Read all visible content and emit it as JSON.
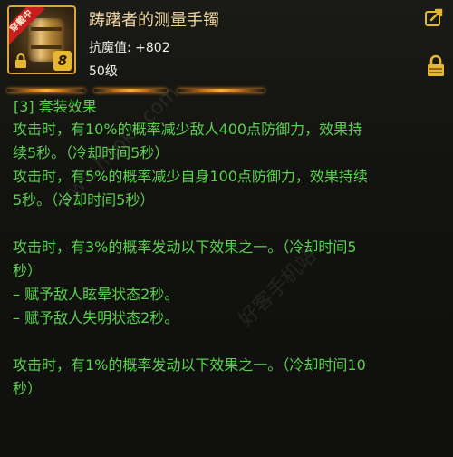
{
  "item": {
    "name": "踌躇者的测量手镯",
    "equip_badge": "穿戴中",
    "tier": "8",
    "stat_label": "抗魔值:",
    "stat_value": "+802",
    "level": "50级"
  },
  "icons": {
    "share": "share-icon",
    "lock": "lock-icon"
  },
  "set_effect": {
    "title": "[3] 套装效果",
    "lines": [
      "攻击时，有10%的概率减少敌人400点防御力，效果持",
      "续5秒。（冷却时间5秒）",
      "攻击时，有5%的概率减少自身100点防御力，效果持续",
      "5秒。（冷却时间5秒）",
      "",
      "攻击时，有3%的概率发动以下效果之一。（冷却时间5",
      "秒）",
      "– 赋予敌人眩晕状态2秒。",
      "– 赋予敌人失明状态2秒。",
      "",
      "攻击时，有1%的概率发动以下效果之一。（冷却时间10",
      "秒）"
    ]
  },
  "watermark": {
    "url": "www.haoke.com",
    "site": "好客手机站"
  },
  "colors": {
    "green_text": "#5ad24e",
    "gold_name": "#f2d6a0",
    "frame": "#d9a640"
  }
}
